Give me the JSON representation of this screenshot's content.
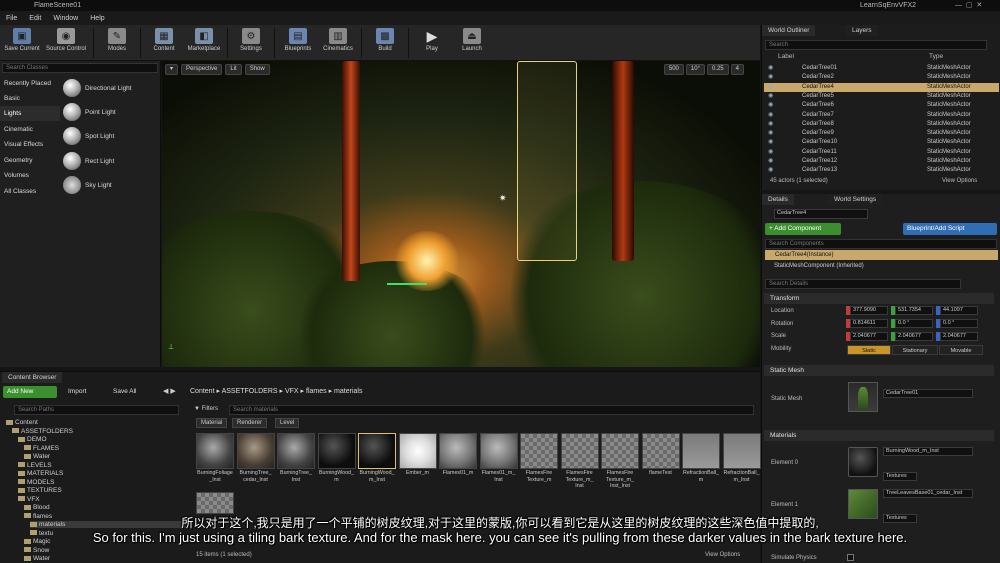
{
  "window": {
    "tab_title": "FlameScene01",
    "project": "LearnSqEnvVFX2"
  },
  "menu": [
    "File",
    "Edit",
    "Window",
    "Help"
  ],
  "toolbar": [
    {
      "label": "Save Current",
      "icon": "save-icon"
    },
    {
      "label": "Source Control",
      "icon": "source-control-icon"
    },
    {
      "label": "Modes",
      "icon": "modes-icon"
    },
    {
      "label": "Content",
      "icon": "content-icon"
    },
    {
      "label": "Marketplace",
      "icon": "marketplace-icon"
    },
    {
      "label": "Settings",
      "icon": "gear-icon"
    },
    {
      "label": "Blueprints",
      "icon": "blueprint-icon"
    },
    {
      "label": "Cinematics",
      "icon": "clapper-icon"
    },
    {
      "label": "Build",
      "icon": "build-icon"
    },
    {
      "label": "Play",
      "icon": "play-icon"
    },
    {
      "label": "Launch",
      "icon": "launch-icon"
    }
  ],
  "modes": {
    "search_placeholder": "Search Classes",
    "categories": [
      "Recently Placed",
      "Basic",
      "Lights",
      "Cinematic",
      "Visual Effects",
      "Geometry",
      "Volumes",
      "All Classes"
    ],
    "selected_category": "Lights",
    "items": [
      "Directional Light",
      "Point Light",
      "Spot Light",
      "Rect Light",
      "Sky Light"
    ]
  },
  "viewport": {
    "left_buttons": [
      "▾",
      "Perspective",
      "Lit",
      "Show"
    ],
    "right_values": [
      "500",
      "10°",
      "0.25",
      "4"
    ]
  },
  "outliner": {
    "tabs": [
      "World Outliner",
      "Layers"
    ],
    "search_placeholder": "Search",
    "col_label": "Label",
    "col_type": "Type",
    "rows": [
      {
        "name": "CedarTree01",
        "type": "StaticMeshActor"
      },
      {
        "name": "CedarTree2",
        "type": "StaticMeshActor"
      },
      {
        "name": "CedarTree4",
        "type": "StaticMeshActor"
      },
      {
        "name": "CedarTree5",
        "type": "StaticMeshActor"
      },
      {
        "name": "CedarTree6",
        "type": "StaticMeshActor"
      },
      {
        "name": "CedarTree7",
        "type": "StaticMeshActor"
      },
      {
        "name": "CedarTree8",
        "type": "StaticMeshActor"
      },
      {
        "name": "CedarTree9",
        "type": "StaticMeshActor"
      },
      {
        "name": "CedarTree10",
        "type": "StaticMeshActor"
      },
      {
        "name": "CedarTree11",
        "type": "StaticMeshActor"
      },
      {
        "name": "CedarTree12",
        "type": "StaticMeshActor"
      },
      {
        "name": "CedarTree13",
        "type": "StaticMeshActor"
      }
    ],
    "selected_index": 2,
    "status": "45 actors (1 selected)",
    "view_options": "View Options"
  },
  "details": {
    "tabs": [
      "Details",
      "World Settings"
    ],
    "name_value": "CedarTree4",
    "add_component": "+ Add Component",
    "blueprint_script": "Blueprint/Add Script",
    "search_components": "Search Components",
    "instance": "CedarTree4(Instance)",
    "component": "StaticMeshComponent (Inherited)",
    "search_details": "Search Details",
    "transform": {
      "title": "Transform",
      "location_label": "Location",
      "rotation_label": "Rotation",
      "scale_label": "Scale",
      "location": [
        "377.9090",
        "531.7354",
        "44.1097"
      ],
      "rotation": [
        "0.814611",
        "0.0 °",
        "0.0 °"
      ],
      "scale": [
        "2.040677",
        "2.040677",
        "2.040677"
      ],
      "mobility_label": "Mobility",
      "mobility": [
        "Static",
        "Stationary",
        "Movable"
      ]
    },
    "static_mesh": {
      "title": "Static Mesh",
      "label": "Static Mesh",
      "value": "CedarTree01"
    },
    "materials": {
      "title": "Materials",
      "element0": "Element 0",
      "element0_value": "BurningWood_m_Inst",
      "textures0": "Textures",
      "element1": "Element 1",
      "element1_value": "TreeLeavesBase01_cedar_Inst",
      "textures1": "Textures"
    },
    "simulate": "Simulate Physics"
  },
  "content_browser": {
    "tab": "Content Browser",
    "add_new": "Add New",
    "import": "Import",
    "save_all": "Save All",
    "path": [
      "Content",
      "ASSETFOLDERS",
      "VFX",
      "flames",
      "materials"
    ],
    "search_paths": "Search Paths",
    "filters": "Filters",
    "search_materials": "Search materials",
    "filter_chips": [
      "Material",
      "Renderer",
      "Level"
    ],
    "tree": [
      {
        "label": "Content",
        "depth": 0
      },
      {
        "label": "ASSETFOLDERS",
        "depth": 1
      },
      {
        "label": "DEMO",
        "depth": 2
      },
      {
        "label": "FLAMES",
        "depth": 3
      },
      {
        "label": "Water",
        "depth": 3
      },
      {
        "label": "LEVELS",
        "depth": 2
      },
      {
        "label": "MATERIALS",
        "depth": 2
      },
      {
        "label": "MODELS",
        "depth": 2
      },
      {
        "label": "TEXTURES",
        "depth": 2
      },
      {
        "label": "VFX",
        "depth": 2
      },
      {
        "label": "Blood",
        "depth": 3
      },
      {
        "label": "flames",
        "depth": 3
      },
      {
        "label": "materials",
        "depth": 4
      },
      {
        "label": "textu",
        "depth": 4
      },
      {
        "label": "Magic",
        "depth": 3
      },
      {
        "label": "Snow",
        "depth": 3
      },
      {
        "label": "Water",
        "depth": 3
      }
    ],
    "assets": [
      {
        "name": "BurningFoliage\n_Inst",
        "style": "foliage"
      },
      {
        "name": "BurningTree_\ncedar_Inst",
        "style": "bark"
      },
      {
        "name": "BurningTree_\nInst",
        "style": "foliage"
      },
      {
        "name": "BurningWood_\nm",
        "style": "dark"
      },
      {
        "name": "BurningWood_\nm_Inst",
        "style": "dark"
      },
      {
        "name": "Ember_m",
        "style": "white"
      },
      {
        "name": "Flames01_m",
        "style": "sphere"
      },
      {
        "name": "Flames01_m_\nInst",
        "style": "sphere"
      },
      {
        "name": "FlamesFire\nTexture_m",
        "style": "checker"
      },
      {
        "name": "FlamesFire\nTexture_m_\nInst",
        "style": "checker"
      },
      {
        "name": "FlamesFire\nTexture_m_\nInst_Inst",
        "style": "checker"
      },
      {
        "name": "flameTest",
        "style": "checker"
      },
      {
        "name": "RefractionBall_\nm",
        "style": "grey"
      },
      {
        "name": "RefractionBall_\nm_Inst",
        "style": "grey"
      }
    ],
    "status": "15 items (1 selected)",
    "view_options": "View Options"
  },
  "subtitles": {
    "zh": "所以对于这个,我只是用了一个平铺的树皮纹理,对于这里的蒙版,你可以看到它是从这里的树皮纹理的这些深色值中提取的,",
    "en": "So for this. I'm just using a tiling bark texture. And for the mask here. you can see it's pulling from these darker values in the bark texture here."
  },
  "colors": {
    "accent_select": "#c9a86b",
    "add_green": "#3b8f2e",
    "blueprint_blue": "#2f6db5",
    "static_orange": "#c8952a"
  }
}
